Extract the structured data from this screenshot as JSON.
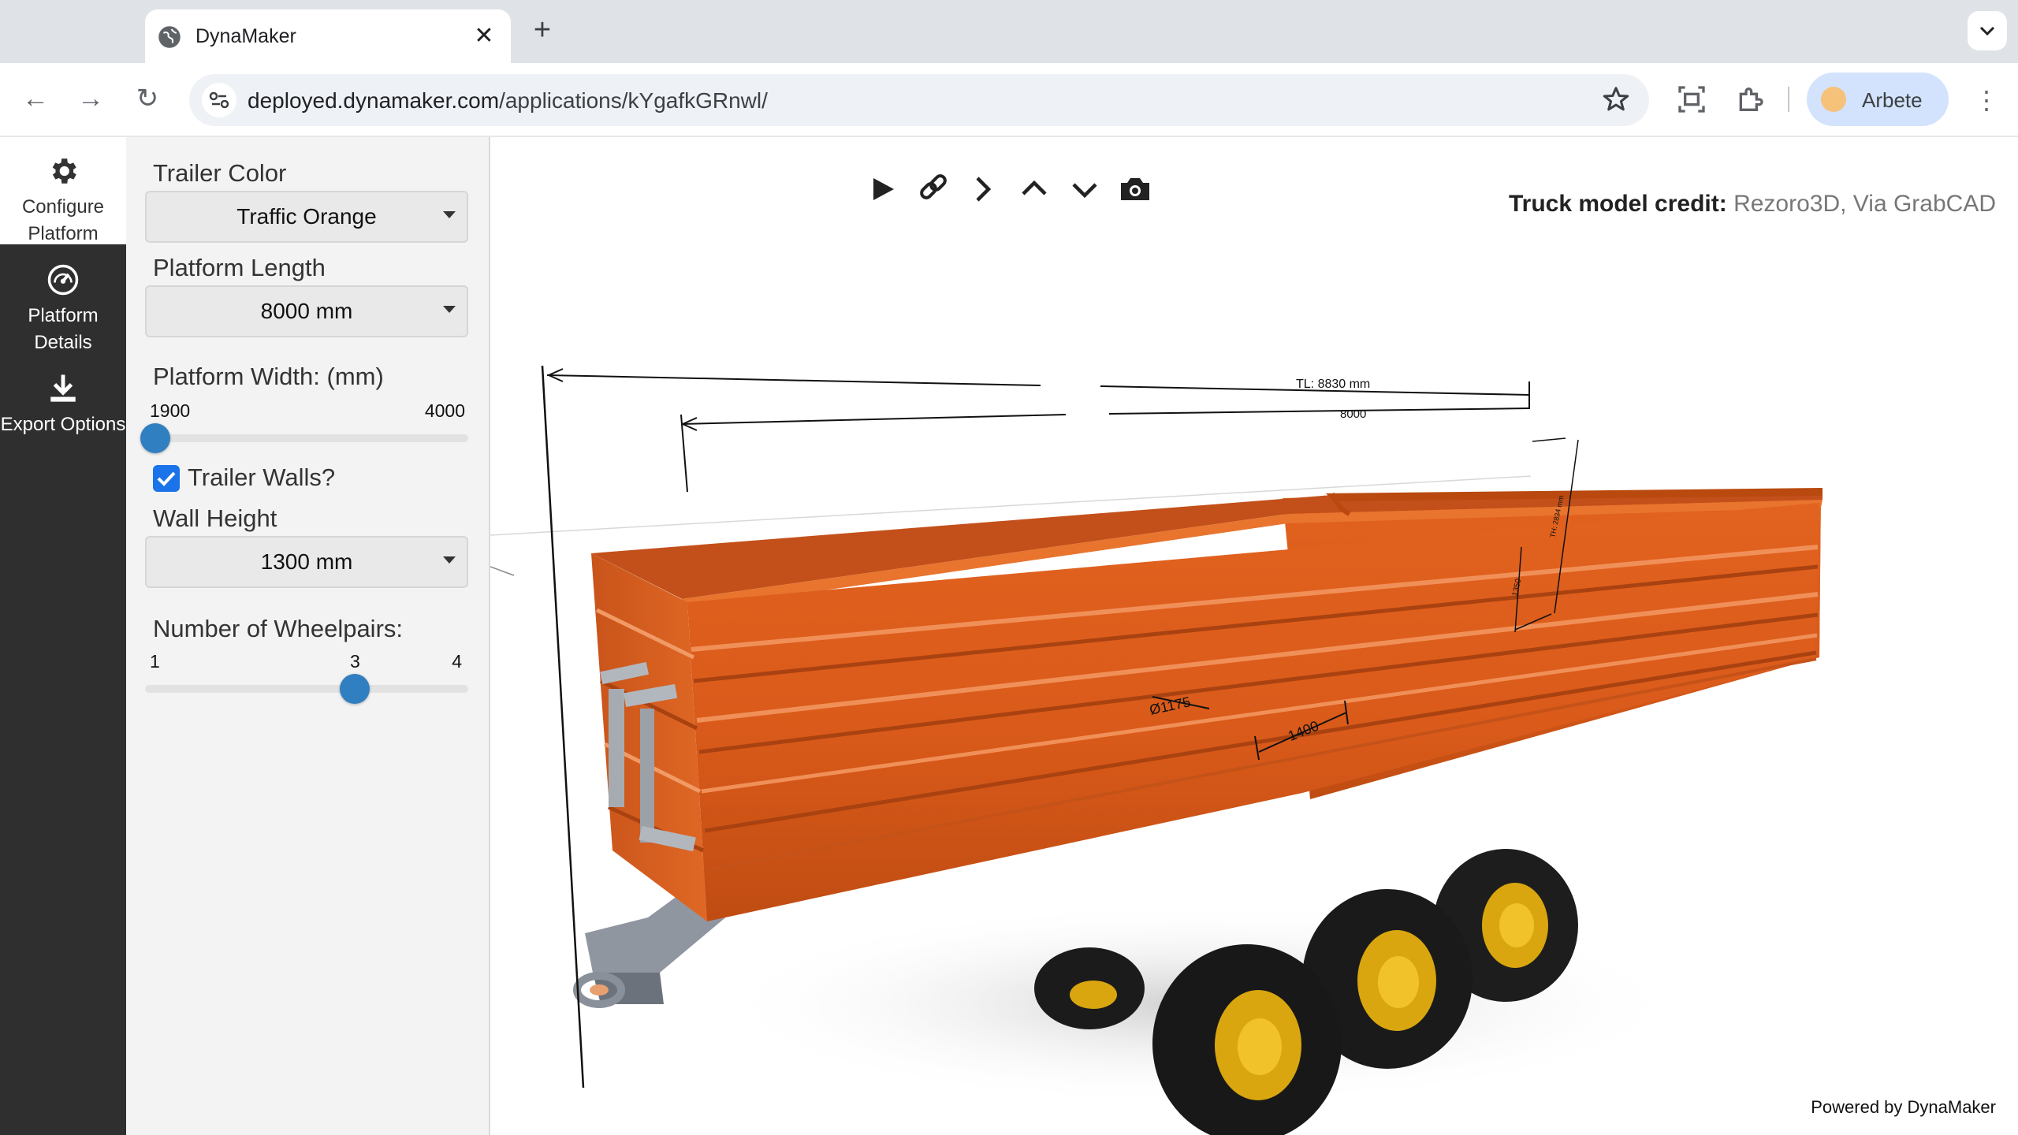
{
  "browser": {
    "tab_title": "DynaMaker",
    "url_host": "deployed.dynamaker.com",
    "url_path": "/applications/kYgafkGRnwl/",
    "profile_name": "Arbete"
  },
  "sidebar": {
    "items": [
      {
        "icon": "gear-icon",
        "label": "Configure Platform",
        "active": true
      },
      {
        "icon": "gauge-icon",
        "label": "Platform Details",
        "active": false
      },
      {
        "icon": "download-icon",
        "label": "Export Options",
        "active": false
      }
    ]
  },
  "config": {
    "trailer_color": {
      "label": "Trailer Color",
      "value": "Traffic Orange"
    },
    "platform_length": {
      "label": "Platform Length",
      "value": "8000 mm"
    },
    "platform_width": {
      "label": "Platform Width: (mm)",
      "min": "1900",
      "max": "4000",
      "value": 1900
    },
    "trailer_walls": {
      "label": "Trailer Walls?",
      "checked": true
    },
    "wall_height": {
      "label": "Wall Height",
      "value": "1300 mm"
    },
    "wheelpairs": {
      "label": "Number of Wheelpairs:",
      "min": "1",
      "max": "4",
      "value": "3"
    }
  },
  "viewer": {
    "toolbar": [
      "play-icon",
      "link-icon",
      "next-icon",
      "up-icon",
      "down-icon",
      "camera-icon"
    ],
    "credit_label": "Truck model credit:",
    "credit_value": "Rezoro3D, Via GrabCAD",
    "powered_by": "Powered by DynaMaker",
    "dimensions": {
      "total_length": "TL: 8830 mm",
      "platform_length": "8000",
      "total_height": "TH: 2834 mm",
      "side_height": "1350",
      "axle_spacing": "1400",
      "wheel_diameter": "Ø1175"
    },
    "accent_color": "#e8611f"
  }
}
